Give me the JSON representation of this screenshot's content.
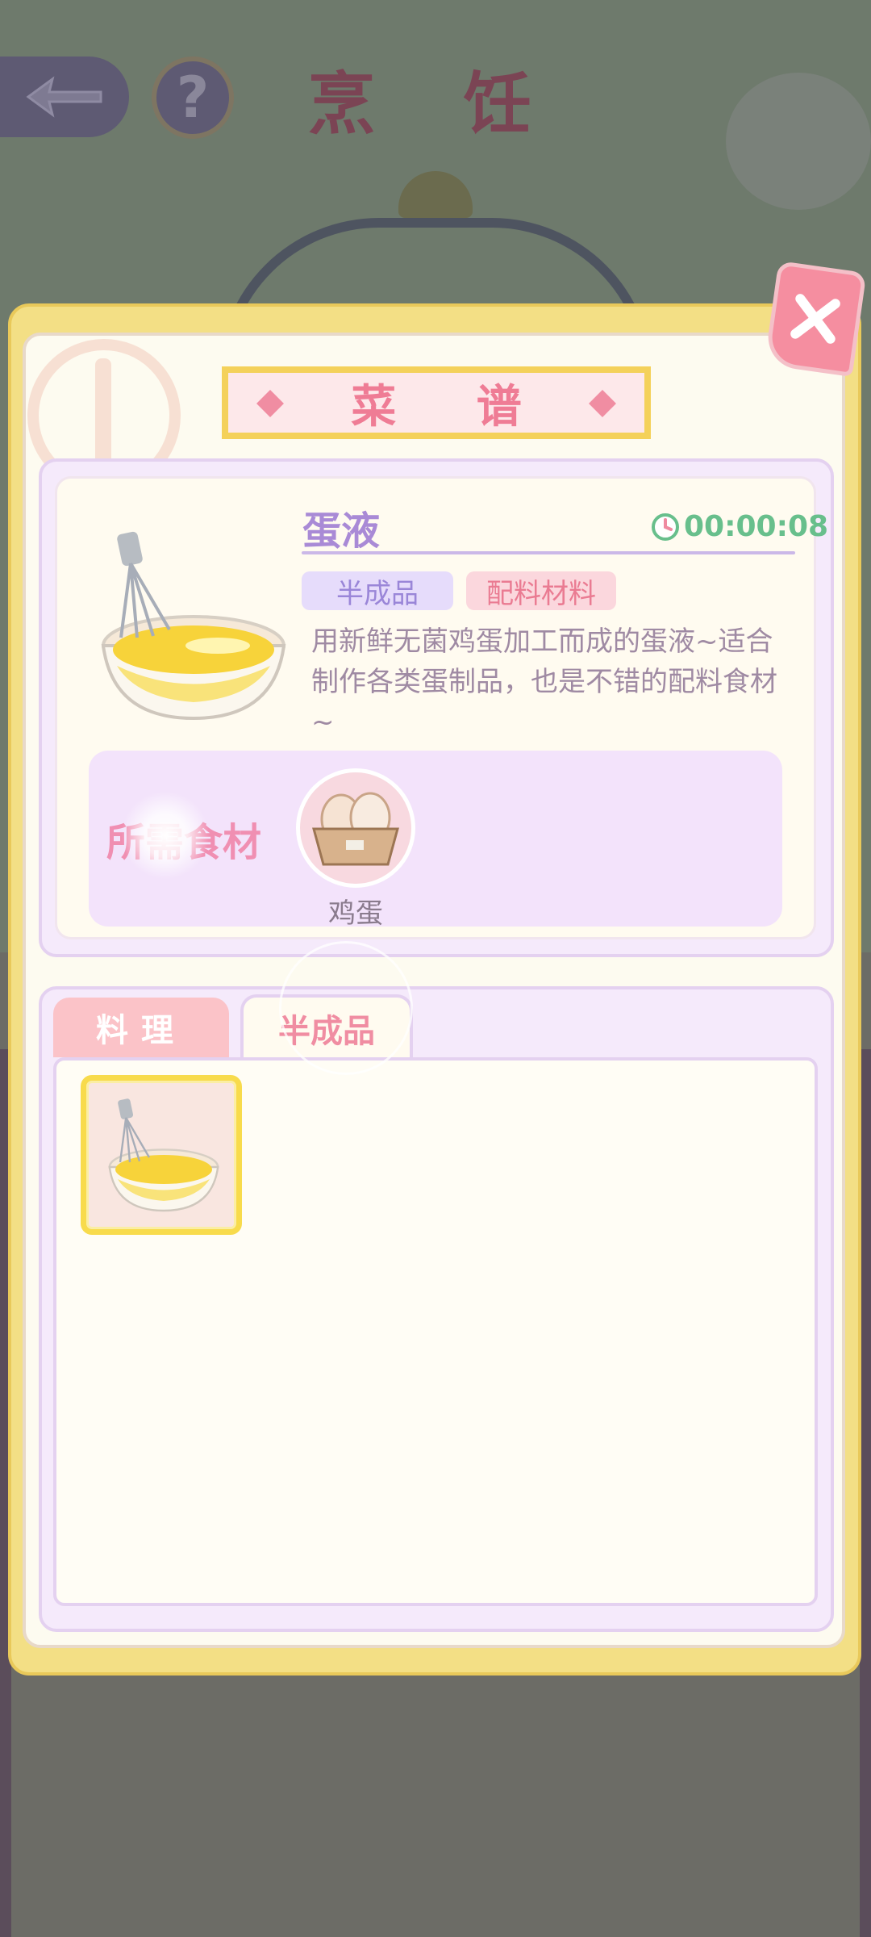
{
  "header": {
    "title": "烹 饪"
  },
  "dialog": {
    "title": "菜 谱"
  },
  "detail": {
    "name": "蛋液",
    "time": "00:00:08",
    "tags": [
      "半成品",
      "配料材料"
    ],
    "description": "用新鲜无菌鸡蛋加工而成的蛋液~适合制作各类蛋制品，也是不错的配料食材~",
    "ingredients_title": "所需食材",
    "ingredients": [
      {
        "name": "鸡蛋",
        "icon": "eggs-carton-icon"
      }
    ]
  },
  "tabs": [
    {
      "label": "料理",
      "active": false
    },
    {
      "label": "半成品",
      "active": true
    }
  ],
  "list_items": [
    {
      "icon": "egg-liquid-bowl-icon",
      "selected": true
    }
  ],
  "colors": {
    "dialog_border": "#f3df85",
    "accent_pink": "#f08da2",
    "accent_purple": "#a98ad6",
    "timer_green": "#68bf8c"
  }
}
